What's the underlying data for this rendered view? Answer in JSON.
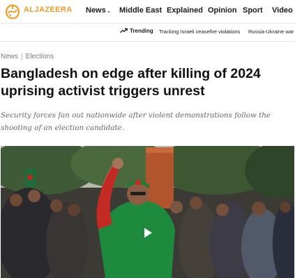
{
  "header": {
    "logo_text": "ALJAZEERA",
    "nav": [
      {
        "label": "News"
      },
      {
        "label": "Middle East"
      },
      {
        "label": "Explained"
      },
      {
        "label": "Opinion"
      },
      {
        "label": "Sport"
      },
      {
        "label": "Video"
      }
    ],
    "nav_chevron": "⌄"
  },
  "trending": {
    "label": "Trending",
    "links": [
      "Tracking Israeli ceasefire violations",
      "Russia-Ukraine war"
    ]
  },
  "article": {
    "breadcrumb": [
      "News",
      "Elections"
    ],
    "breadcrumb_separator": "|",
    "headline": "Bangladesh on edge after killing of 2024 uprising activist triggers unrest",
    "subhead": "Security forces fan out nationwide after violent demonstrations follow the shooting of an election candidate."
  },
  "colors": {
    "brand_orange": "#f59a23",
    "text": "#1a1a1a",
    "muted": "#777777"
  },
  "icons": {
    "logo": "aljazeera-calligraphy-icon",
    "trending": "trending-arrow-icon",
    "play": "play-icon"
  }
}
